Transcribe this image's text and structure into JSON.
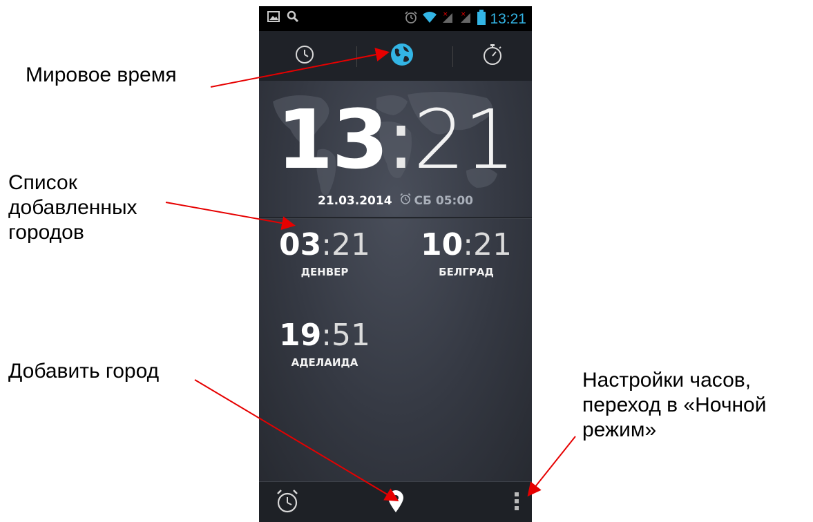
{
  "annotations": {
    "world_time": "Мировое время",
    "cities_list": [
      "Список",
      "добавленных",
      "городов"
    ],
    "add_city": "Добавить город",
    "settings": [
      "Настройки часов,",
      "переход в «Ночной",
      "режим»"
    ]
  },
  "status_bar": {
    "time": "13:21",
    "accent_color": "#33b5e5"
  },
  "tabs": [
    {
      "name": "alarm-clock-tab",
      "icon": "clock-icon",
      "active": false
    },
    {
      "name": "world-clock-tab",
      "icon": "globe-icon",
      "active": true
    },
    {
      "name": "stopwatch-tab",
      "icon": "stopwatch-icon",
      "active": false
    }
  ],
  "main_clock": {
    "hours": "13",
    "separator": ":",
    "minutes": "21",
    "date": "21.03.2014",
    "next_alarm": "СБ 05:00"
  },
  "cities": [
    {
      "hours": "03",
      "minutes": "21",
      "name": "ДЕНВЕР"
    },
    {
      "hours": "10",
      "minutes": "21",
      "name": "БЕЛГРАД"
    },
    {
      "hours": "19",
      "minutes": "51",
      "name": "АДЕЛАИДА"
    }
  ],
  "bottom_bar": {
    "left_icon": "alarm-icon",
    "center_icon": "location-pin-icon",
    "right_icon": "overflow-menu-icon"
  }
}
